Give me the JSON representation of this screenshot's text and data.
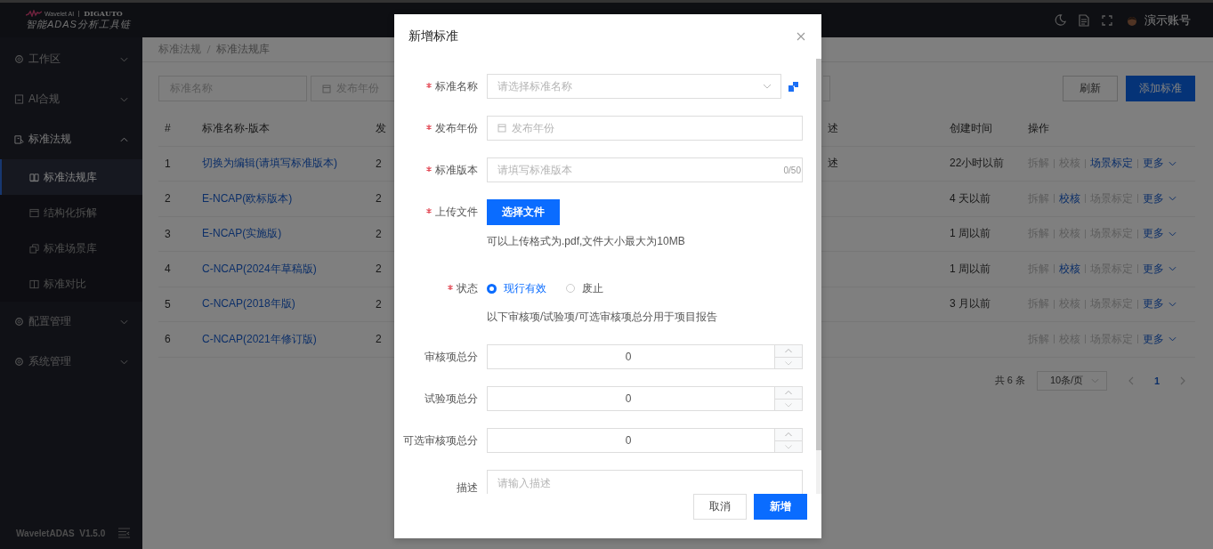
{
  "app": {
    "brand": "Wavelet AI",
    "partner": "DIGAUTO",
    "product": "智能ADAS分析工具链",
    "version": "WaveletADAS  V1.5.0"
  },
  "topbar": {
    "user": "演示账号"
  },
  "sidebar": {
    "items": [
      {
        "label": "工作区",
        "selected": false,
        "expanded": false
      },
      {
        "label": "AI合规",
        "selected": false,
        "expanded": false
      },
      {
        "label": "标准法规",
        "selected": true,
        "expanded": true,
        "children": [
          {
            "label": "标准法规库",
            "selected": true
          },
          {
            "label": "结构化拆解",
            "selected": false
          },
          {
            "label": "标准场景库",
            "selected": false
          },
          {
            "label": "标准对比",
            "selected": false
          }
        ]
      },
      {
        "label": "配置管理",
        "selected": false,
        "expanded": false
      },
      {
        "label": "系统管理",
        "selected": false,
        "expanded": false
      }
    ]
  },
  "breadcrumb": [
    "标准法规",
    "标准法规库"
  ],
  "filters": {
    "name_placeholder": "标准名称",
    "year_placeholder": "发布年份"
  },
  "toolbar": {
    "refresh": "刷新",
    "add": "添加标准"
  },
  "table": {
    "columns": [
      "#",
      "标准名称-版本",
      "发",
      "述",
      "创建时间",
      "操作"
    ],
    "rows": [
      {
        "index": "1",
        "name": "切换为编辑(请填写标准版本)",
        "column_3": "2",
        "column_4": "述",
        "created": "22小时以前",
        "actions": [
          {
            "label": "拆解",
            "disabled": true
          },
          {
            "label": "校核",
            "disabled": true
          },
          {
            "label": "场景标定",
            "disabled": false
          }
        ],
        "more": "更多"
      },
      {
        "index": "2",
        "name": "E-NCAP(欧标版本)",
        "column_3": "2",
        "created": "4 天以前",
        "actions": [
          {
            "label": "拆解",
            "disabled": true
          },
          {
            "label": "校核",
            "disabled": false
          },
          {
            "label": "场景标定",
            "disabled": true
          }
        ],
        "more": "更多"
      },
      {
        "index": "3",
        "name": "E-NCAP(实施版)",
        "column_3": "2",
        "created": "1 周以前",
        "actions": [
          {
            "label": "拆解",
            "disabled": true
          },
          {
            "label": "校核",
            "disabled": true
          },
          {
            "label": "场景标定",
            "disabled": true
          }
        ],
        "more": "更多"
      },
      {
        "index": "4",
        "name": "C-NCAP(2024年草稿版)",
        "column_3": "2",
        "created": "1 周以前",
        "actions": [
          {
            "label": "拆解",
            "disabled": true
          },
          {
            "label": "校核",
            "disabled": false
          },
          {
            "label": "场景标定",
            "disabled": true
          }
        ],
        "more": "更多"
      },
      {
        "index": "5",
        "name": "C-NCAP(2018年版)",
        "column_3": "2",
        "created": "3 月以前",
        "actions": [
          {
            "label": "拆解",
            "disabled": true
          },
          {
            "label": "校核",
            "disabled": true
          },
          {
            "label": "场景标定",
            "disabled": true
          }
        ],
        "more": "更多"
      },
      {
        "index": "6",
        "name": "C-NCAP(2021年修订版)",
        "column_3": "2",
        "actions": [
          {
            "label": "拆解",
            "disabled": true
          },
          {
            "label": "校核",
            "disabled": true
          },
          {
            "label": "场景标定",
            "disabled": true
          }
        ],
        "more": "更多"
      }
    ]
  },
  "pagination": {
    "total": "共 6 条",
    "page_size": "10条/页",
    "pages": [
      {
        "label": "1",
        "selected": true
      }
    ]
  },
  "dialog": {
    "title": "新增标准",
    "fields": [
      {
        "kind": "select",
        "label": "标准名称",
        "required": true,
        "placeholder": "请选择标准名称"
      },
      {
        "kind": "date",
        "label": "发布年份",
        "required": true,
        "placeholder": "发布年份"
      },
      {
        "kind": "text",
        "label": "标准版本",
        "required": true,
        "placeholder": "请填写标准版本",
        "counter": "0/50"
      },
      {
        "kind": "upload",
        "label": "上传文件",
        "required": true,
        "button": "选择文件",
        "help": "可以上传格式为.pdf,文件大小最大为10MB"
      },
      {
        "kind": "radio",
        "label": "状态",
        "required": true,
        "options": [
          {
            "label": "现行有效",
            "selected": true
          },
          {
            "label": "废止",
            "selected": false
          }
        ],
        "help": "以下审核项/试验项/可选审核项总分用于项目报告"
      },
      {
        "kind": "number",
        "label": "审核项总分",
        "required": false,
        "value": "0"
      },
      {
        "kind": "number",
        "label": "试验项总分",
        "required": false,
        "value": "0"
      },
      {
        "kind": "number",
        "label": "可选审核项总分",
        "required": false,
        "value": "0"
      },
      {
        "kind": "textarea",
        "label": "描述",
        "required": false,
        "placeholder": "请输入描述"
      }
    ],
    "cancel": "取消",
    "submit": "新增"
  }
}
